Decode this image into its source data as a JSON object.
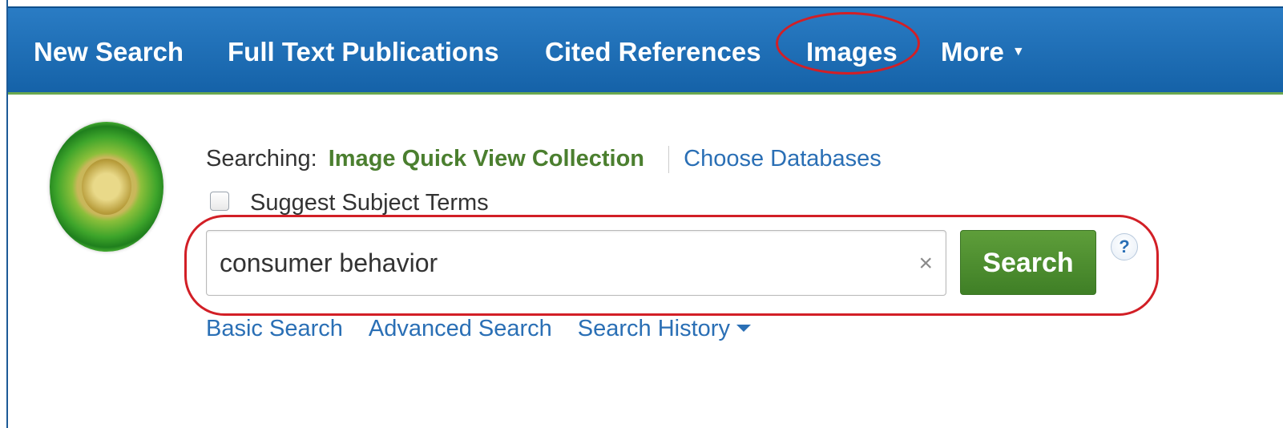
{
  "nav": {
    "new_search": "New Search",
    "full_text": "Full Text Publications",
    "cited_refs": "Cited References",
    "images": "Images",
    "more": "More"
  },
  "search": {
    "searching_label": "Searching:",
    "collection": "Image Quick View Collection",
    "choose_databases": "Choose Databases",
    "suggest_label": "Suggest Subject Terms",
    "suggest_checked": false,
    "query": "consumer behavior",
    "button_label": "Search",
    "help_symbol": "?"
  },
  "links": {
    "basic": "Basic Search",
    "advanced": "Advanced Search",
    "history": "Search History"
  },
  "icons": [
    "seal-logo-icon",
    "clear-x-icon",
    "help-question-icon",
    "caret-down-icon"
  ],
  "colors": {
    "nav_bg": "#1e6db4",
    "link": "#2a6fb5",
    "collection_green": "#4b7f2f",
    "search_button": "#4a8a2e",
    "highlight_ring": "#d21f26"
  }
}
